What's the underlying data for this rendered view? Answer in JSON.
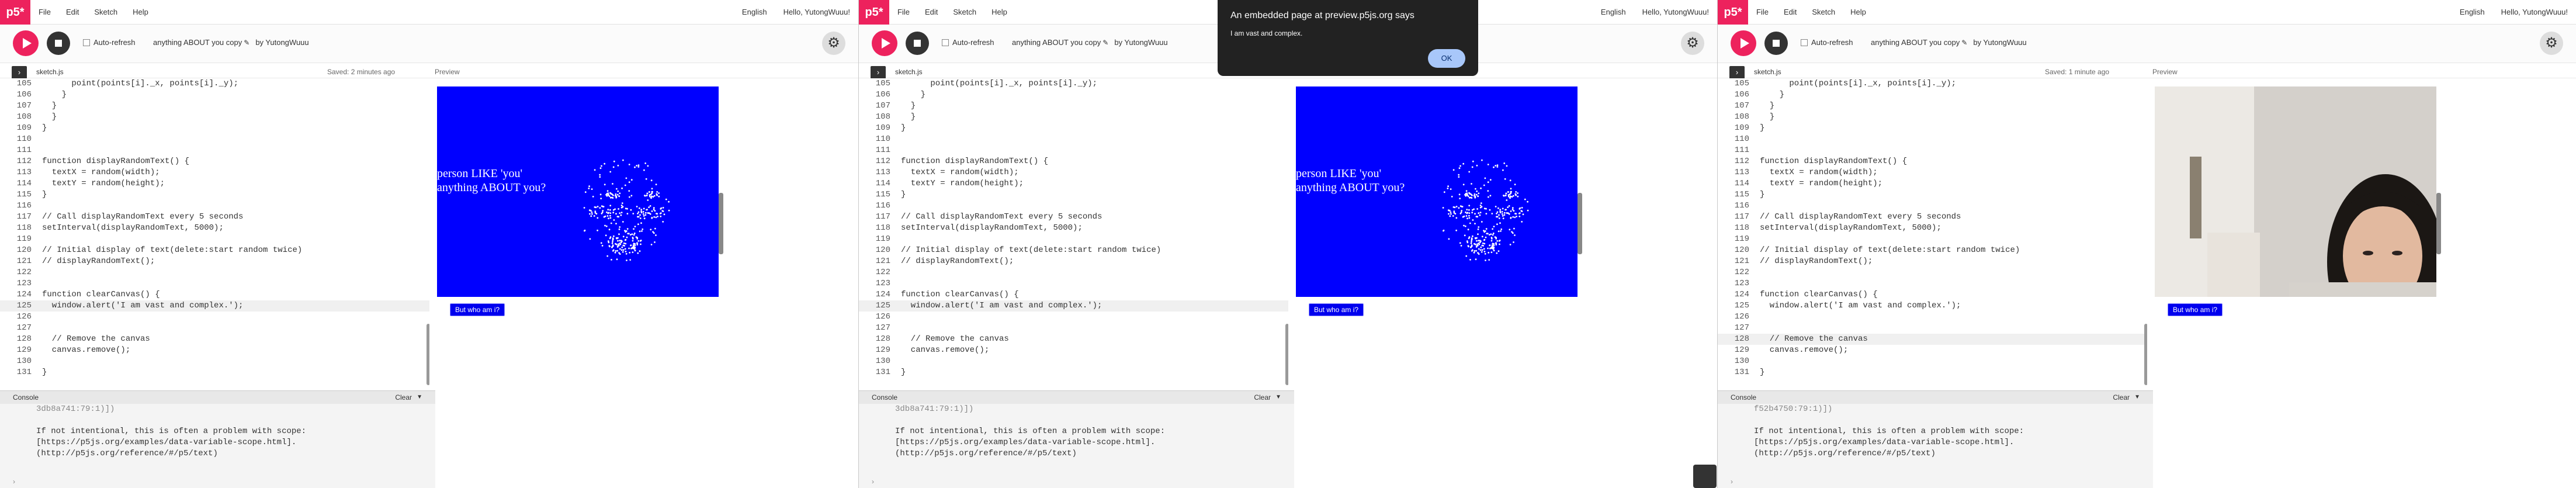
{
  "nav": {
    "logo": "p5*",
    "menus": [
      "File",
      "Edit",
      "Sketch",
      "Help"
    ],
    "language": "English",
    "greeting": "Hello, YutongWuuu!"
  },
  "toolbar": {
    "auto_refresh": "Auto-refresh",
    "sketch_name": "anything ABOUT you copy",
    "by": "by YutongWuuu"
  },
  "panels": [
    {
      "file_name": "sketch.js",
      "saved": "Saved: 2 minutes ago",
      "preview_label": "Preview",
      "preview_mode": "canvas",
      "preview_line1": "person LIKE 'you'",
      "preview_line2": "anything ABOUT you?",
      "button_label": "But who am i?",
      "console_title": "Console",
      "console_clear": "Clear",
      "console_line1": "3db8a741:79:1)])",
      "console_line2": "If not intentional, this is often a problem with scope: [https://p5js.org/examples/data-variable-scope.html]. (http://p5js.org/reference/#/p5/text)",
      "dialog": null,
      "highlight_line": "125"
    },
    {
      "file_name": "sketch.js",
      "saved": "",
      "preview_label": "Preview",
      "preview_mode": "canvas",
      "preview_line1": "person LIKE 'you'",
      "preview_line2": "anything ABOUT you?",
      "button_label": "But who am i?",
      "console_title": "Console",
      "console_clear": "Clear",
      "console_line1": "3db8a741:79:1)])",
      "console_line2": "If not intentional, this is often a problem with scope: [https://p5js.org/examples/data-variable-scope.html]. (http://p5js.org/reference/#/p5/text)",
      "dialog": {
        "title": "An embedded page at preview.p5js.org says",
        "message": "I am vast and complex.",
        "ok": "OK"
      },
      "highlight_line": "125"
    },
    {
      "file_name": "sketch.js",
      "saved": "Saved: 1 minute ago",
      "preview_label": "Preview",
      "preview_mode": "camera",
      "preview_line1": "",
      "preview_line2": "",
      "button_label": "But who am i?",
      "console_title": "Console",
      "console_clear": "Clear",
      "console_line1": "f52b4750:79:1)])",
      "console_line2": "If not intentional, this is often a problem with scope: [https://p5js.org/examples/data-variable-scope.html]. (http://p5js.org/reference/#/p5/text)",
      "dialog": null,
      "highlight_line": "128"
    }
  ],
  "code": [
    {
      "n": "105",
      "t": "      point(points[i]._x, points[i]._y);"
    },
    {
      "n": "106",
      "t": "    }"
    },
    {
      "n": "107",
      "t": "  }"
    },
    {
      "n": "108",
      "t": "  }"
    },
    {
      "n": "109",
      "t": "}"
    },
    {
      "n": "110",
      "t": ""
    },
    {
      "n": "111",
      "t": ""
    },
    {
      "n": "112",
      "t": "function displayRandomText() {"
    },
    {
      "n": "113",
      "t": "  textX = random(width);"
    },
    {
      "n": "114",
      "t": "  textY = random(height);"
    },
    {
      "n": "115",
      "t": "}"
    },
    {
      "n": "116",
      "t": ""
    },
    {
      "n": "117",
      "t": "// Call displayRandomText every 5 seconds"
    },
    {
      "n": "118",
      "t": "setInterval(displayRandomText, 5000);"
    },
    {
      "n": "119",
      "t": ""
    },
    {
      "n": "120",
      "t": "// Initial display of text(delete:start random twice)"
    },
    {
      "n": "121",
      "t": "// displayRandomText();"
    },
    {
      "n": "122",
      "t": ""
    },
    {
      "n": "123",
      "t": ""
    },
    {
      "n": "124",
      "t": "function clearCanvas() {"
    },
    {
      "n": "125",
      "t": "  window.alert('I am vast and complex.');"
    },
    {
      "n": "126",
      "t": ""
    },
    {
      "n": "127",
      "t": ""
    },
    {
      "n": "128",
      "t": "  // Remove the canvas"
    },
    {
      "n": "129",
      "t": "  canvas.remove();"
    },
    {
      "n": "130",
      "t": ""
    },
    {
      "n": "131",
      "t": "}"
    }
  ],
  "colors": {
    "brand": "#ed225d",
    "canvas_bg": "#0000ff",
    "button_bg": "#0000ee"
  },
  "icons": [
    "play-icon",
    "stop-icon",
    "gear-icon",
    "chevron-right-icon",
    "pencil-icon",
    "chevron-down-icon"
  ]
}
